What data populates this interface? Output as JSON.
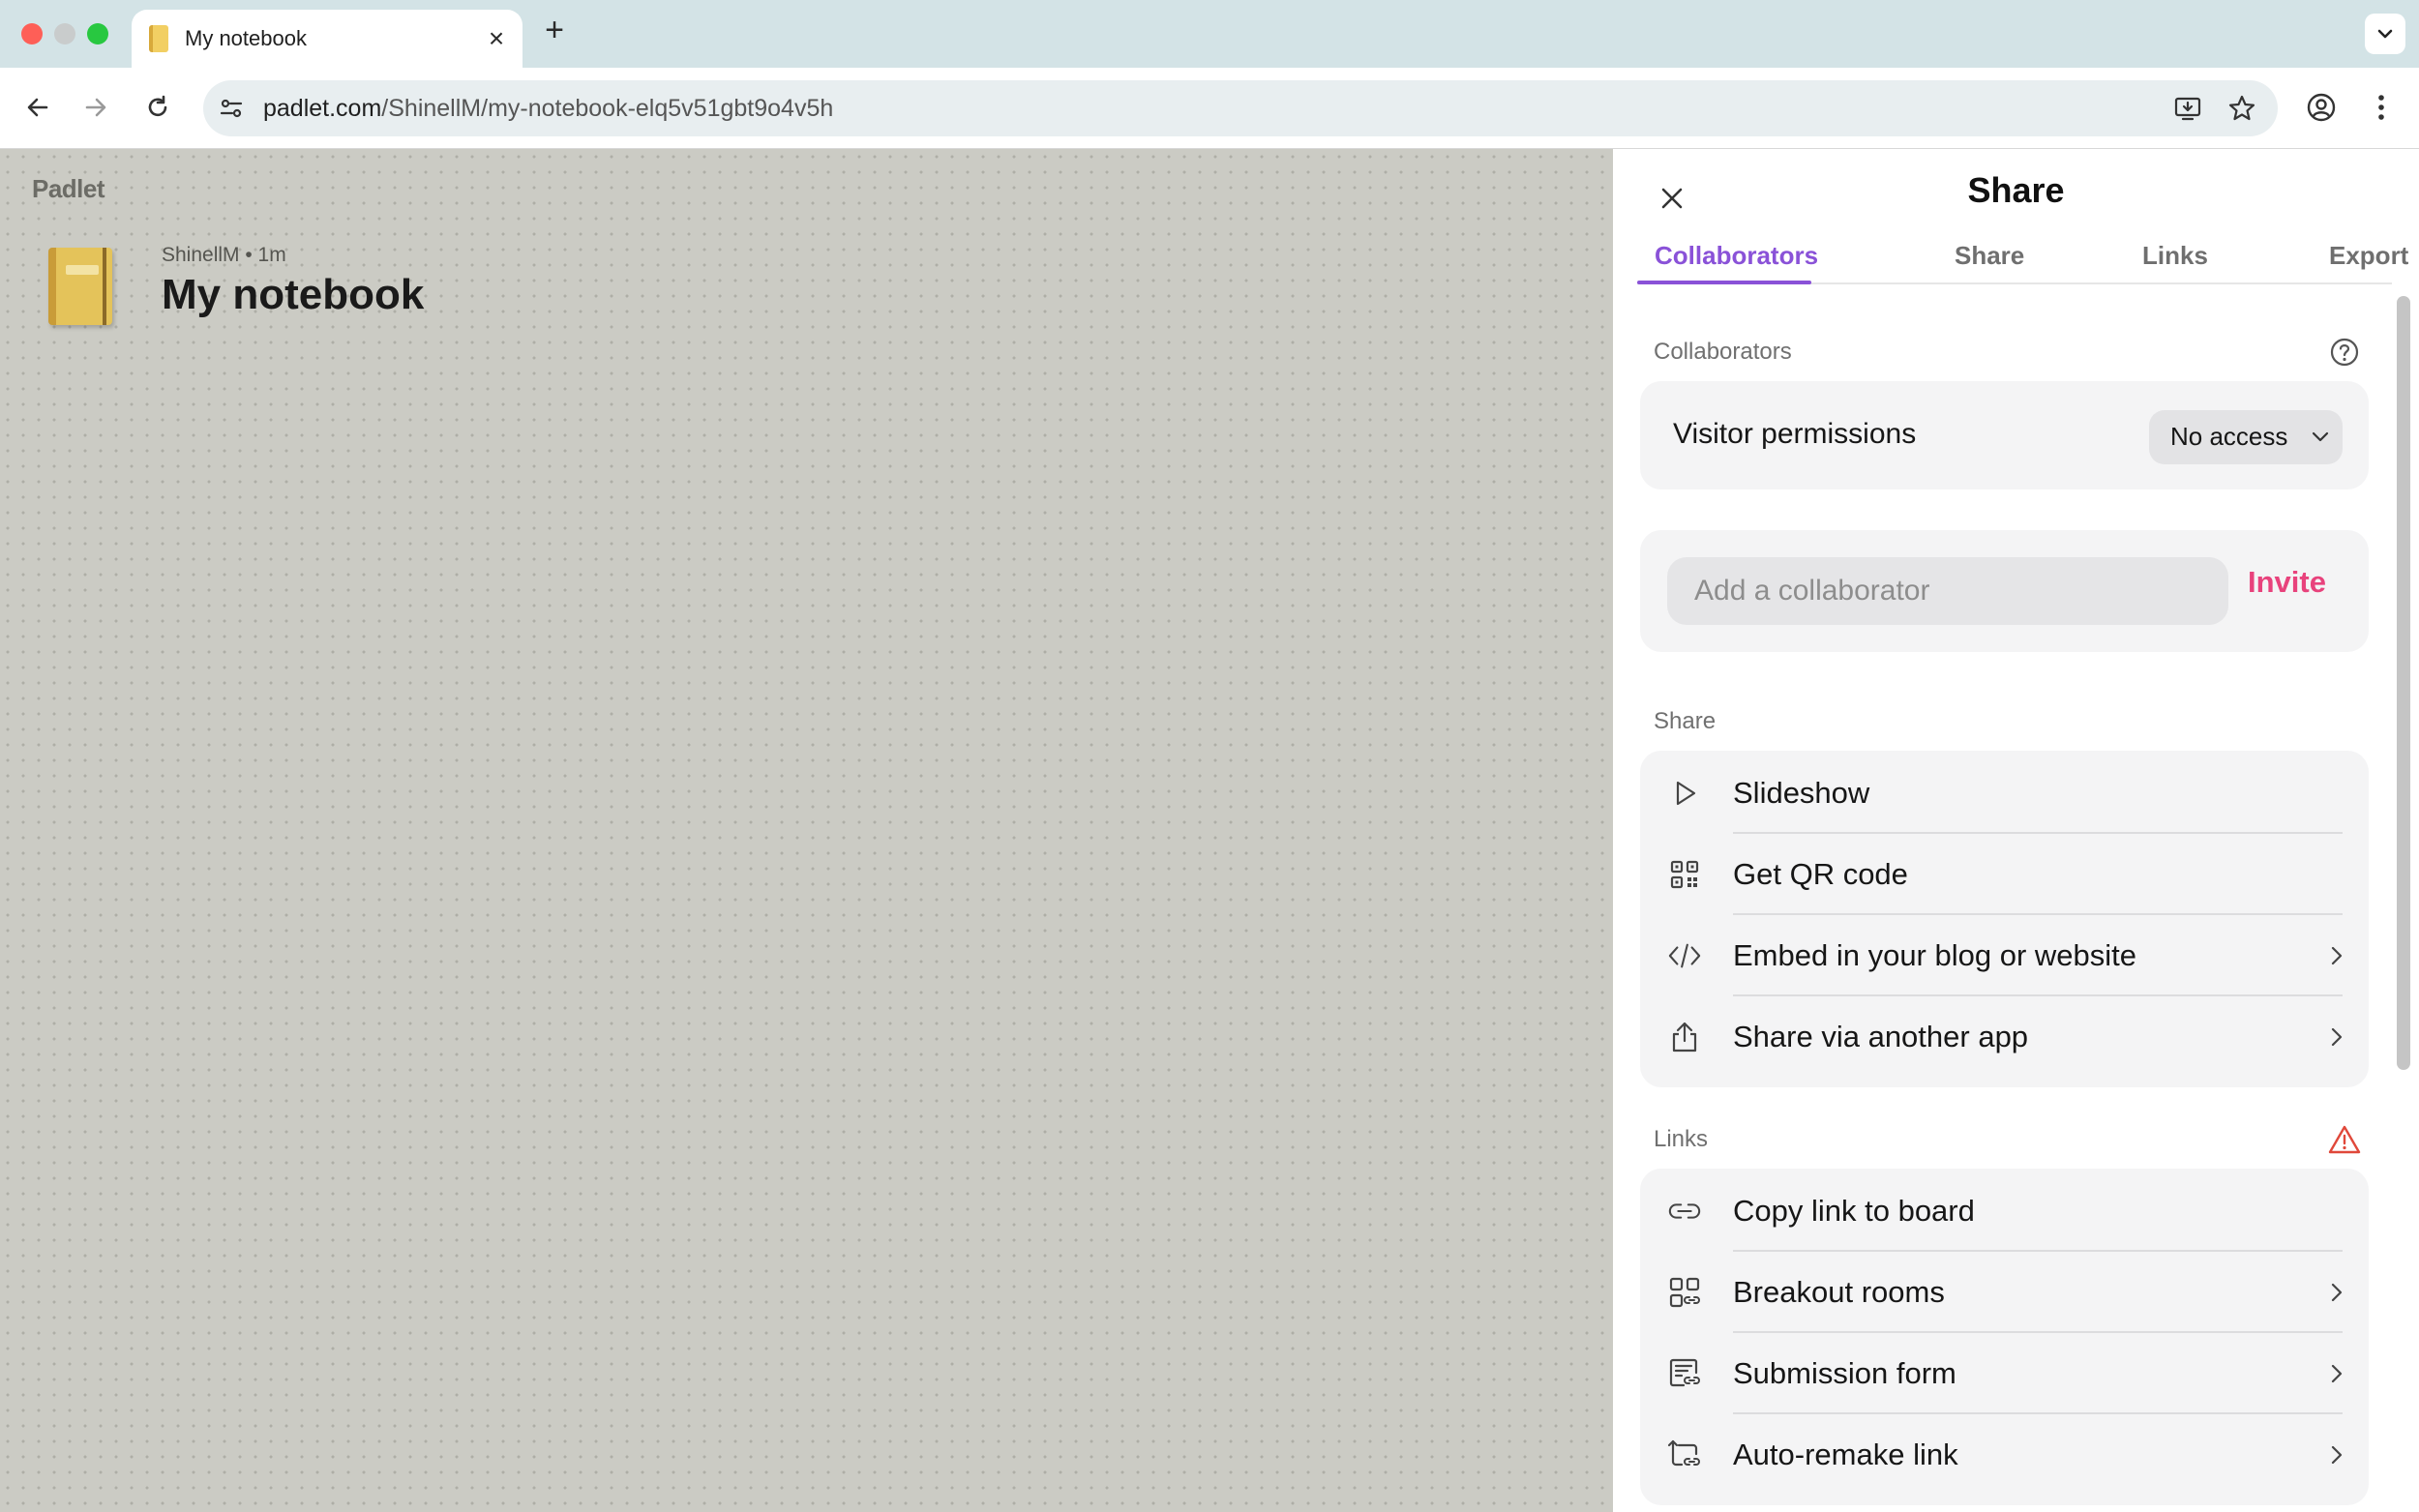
{
  "browser": {
    "tab_title": "My notebook",
    "url_domain": "padlet.com",
    "url_path": "/ShinellM/my-notebook-elq5v51gbt9o4v5h"
  },
  "board": {
    "logo": "Padlet",
    "meta": "ShinellM • 1m",
    "title": "My notebook"
  },
  "panel": {
    "title": "Share",
    "tabs": [
      "Collaborators",
      "Share",
      "Links",
      "Export"
    ],
    "active_tab": "Collaborators",
    "collaborators_section": {
      "label": "Collaborators",
      "visitor_permissions_label": "Visitor permissions",
      "visitor_permissions_value": "No access",
      "add_placeholder": "Add a collaborator",
      "invite_label": "Invite"
    },
    "share_section": {
      "label": "Share",
      "items": [
        {
          "label": "Slideshow",
          "icon": "play-icon"
        },
        {
          "label": "Get QR code",
          "icon": "qr-code-icon"
        },
        {
          "label": "Embed in your blog or website",
          "icon": "code-icon"
        },
        {
          "label": "Share via another app",
          "icon": "share-icon"
        }
      ]
    },
    "links_section": {
      "label": "Links",
      "items": [
        {
          "label": "Copy link to board",
          "icon": "link-icon"
        },
        {
          "label": "Breakout rooms",
          "icon": "grid-link-icon"
        },
        {
          "label": "Submission form",
          "icon": "form-link-icon"
        },
        {
          "label": "Auto-remake link",
          "icon": "remake-link-icon"
        }
      ]
    }
  },
  "colors": {
    "accent_purple": "#8a52d8",
    "invite_pink": "#e8427c",
    "warning_red": "#e0483a",
    "board_bg": "#cbcbc4"
  }
}
